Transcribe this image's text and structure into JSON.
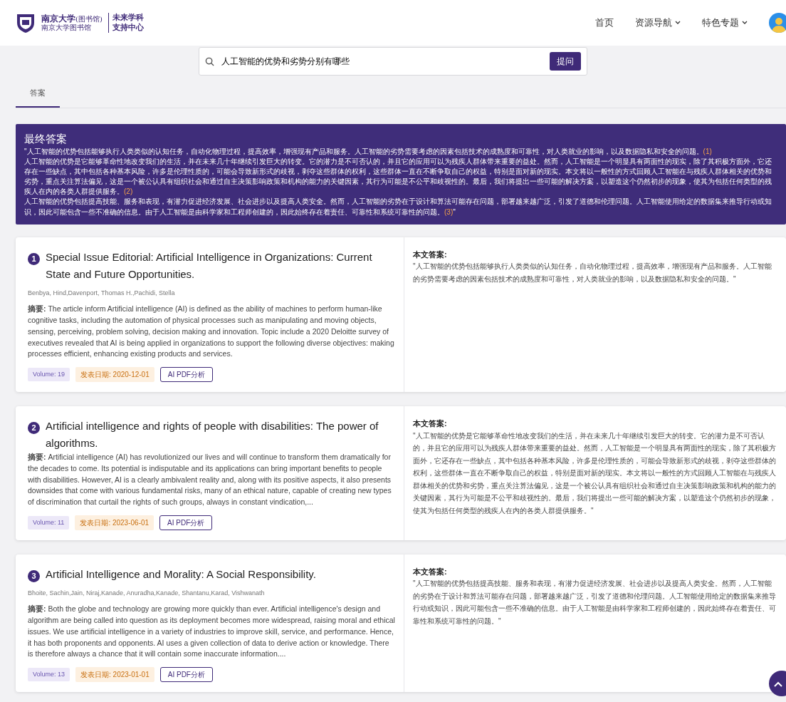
{
  "header": {
    "logo_line1": "南京大学",
    "logo_line1_small": "(图书馆)",
    "logo_line2": "南京大学图书馆",
    "logo_right_line1": "未来学科",
    "logo_right_line2": "支持中心",
    "nav": [
      {
        "label": "首页",
        "dropdown": false
      },
      {
        "label": "资源导航",
        "dropdown": true
      },
      {
        "label": "特色专题",
        "dropdown": true
      }
    ]
  },
  "search": {
    "value": "人工智能的优势和劣势分别有哪些",
    "button": "提问"
  },
  "tabs": [
    {
      "label": "答案",
      "selected": true
    }
  ],
  "final_answer": {
    "title": "最终答案",
    "closing_quote": "\"",
    "paragraphs": [
      {
        "text": "\"人工智能的优势包括能够执行人类类似的认知任务，自动化物理过程，提高效率，增强现有产品和服务。人工智能的劣势需要考虑的因素包括技术的成熟度和可靠性，对人类就业的影响，以及数据隐私和安全的问题。",
        "ref": "(1)"
      },
      {
        "text": "人工智能的优势是它能够革命性地改变我们的生活，并在未来几十年继续引发巨大的转变。它的潜力是不可否认的，并且它的应用可以为残疾人群体带来重要的益处。然而，人工智能是一个明显具有两面性的现实，除了其积极方面外，它还存在一些缺点，其中包括各种基本风险，许多是伦理性质的，可能会导致新形式的歧视，剥夺这些群体的权利，这些群体一直在不断争取自己的权益，特别是面对新的现实。本文将以一般性的方式回顾人工智能在与残疾人群体相关的优势和劣势，重点关注算法偏见，这是一个被公认具有组织社会和通过自主决策影响政策和机构的能力的关键因素，其行为可能是不公平和歧视性的。最后，我们将提出一些可能的解决方案，以塑造这个仍然初步的现象，使其为包括任何类型的残疾人在内的各类人群提供服务。",
        "ref": "(2)"
      },
      {
        "text": "人工智能的优势包括提高技能、服务和表现，有潜力促进经济发展、社会进步以及提高人类安全。然而，人工智能的劣势在于设计和算法可能存在问题，部署越来越广泛，引发了道德和伦理问题。人工智能使用给定的数据集来推导行动或知识，因此可能包含一些不准确的信息。由于人工智能是由科学家和工程师创建的，因此始终存在着责任、可靠性和系统可靠性的问题。",
        "ref": "(3)"
      }
    ]
  },
  "papers": [
    {
      "number": "1",
      "title": "Special Issue Editorial: Artificial Intelligence in Organizations: Current State and Future Opportunities.",
      "authors": "Benbya, Hind,Davenport, Thomas H.,Pachidi, Stella",
      "abstract_label": "摘要:",
      "abstract": "The article inform Artificial intelligence (AI) is defined as the ability of machines to perform human-like cognitive tasks, including the automation of physical processes such as manipulating and moving objects, sensing, perceiving, problem solving, decision making and innovation. Topic include a 2020 Deloitte survey of executives revealed that AI is being applied in organizations to support the following diverse objectives: making processes efficient, enhancing existing products and services.",
      "volume": "Volume: 19",
      "date": "发表日期: 2020-12-01",
      "button": "AI PDF分析",
      "answer_label": "本文答案:",
      "answer": "\"人工智能的优势包括能够执行人类类似的认知任务，自动化物理过程，提高效率，增强现有产品和服务。人工智能的劣势需要考虑的因素包括技术的成熟度和可靠性，对人类就业的影响，以及数据隐私和安全的问题。\""
    },
    {
      "number": "2",
      "title": "Artificial intelligence and rights of people with disabilities: The power of algorithms.",
      "abstract_label": "摘要:",
      "abstract": "Artificial intelligence (AI) has revolutionized our lives and will continue to transform them dramatically for the decades to come. Its potential is indisputable and its applications can bring important benefits to people with disabilities. However, AI is a clearly ambivalent reality and, along with its positive aspects, it also presents downsides that come with various fundamental risks, many of an ethical nature, capable of creating new types of discrimination that curtail the rights of such groups, always in constant vindication,...",
      "volume": "Volume: 11",
      "date": "发表日期: 2023-06-01",
      "button": "AI PDF分析",
      "answer_label": "本文答案:",
      "answer": "\"人工智能的优势是它能够革命性地改变我们的生活，并在未来几十年继续引发巨大的转变。它的潜力是不可否认的，并且它的应用可以为残疾人群体带来重要的益处。然而，人工智能是一个明显具有两面性的现实，除了其积极方面外，它还存在一些缺点，其中包括各种基本风险，许多是伦理性质的，可能会导致新形式的歧视，剥夺这些群体的权利，这些群体一直在不断争取自己的权益，特别是面对新的现实。本文将以一般性的方式回顾人工智能在与残疾人群体相关的优势和劣势，重点关注算法偏见，这是一个被公认具有组织社会和通过自主决策影响政策和机构的能力的关键因素，其行为可能是不公平和歧视性的。最后，我们将提出一些可能的解决方案，以塑造这个仍然初步的现象，使其为包括任何类型的残疾人在内的各类人群提供服务。\""
    },
    {
      "number": "3",
      "title": "Artificial Intelligence and Morality: A Social Responsibility.",
      "authors": "Bhoite, Sachin,Jain, Niraj,Kanade, Anuradha,Kanade, Shantanu,Karad, Vishwanath",
      "abstract_label": "摘要:",
      "abstract": "Both the globe and technology are growing more quickly than ever. Artificial intelligence's design and algorithm are being called into question as its deployment becomes more widespread, raising moral and ethical issues. We use artificial intelligence in a variety of industries to improve skill, service, and performance. Hence, it has both proponents and opponents. AI uses a given collection of data to derive action or knowledge. There is therefore always a chance that it will contain some inaccurate information....",
      "volume": "Volume: 13",
      "date": "发表日期: 2023-01-01",
      "button": "AI PDF分析",
      "answer_label": "本文答案:",
      "answer": "\"人工智能的优势包括提高技能、服务和表现，有潜力促进经济发展、社会进步以及提高人类安全。然而，人工智能的劣势在于设计和算法可能存在问题，部署越来越广泛，引发了道德和伦理问题。人工智能使用给定的数据集来推导行动或知识，因此可能包含一些不准确的信息。由于人工智能是由科学家和工程师创建的，因此始终存在着责任、可靠性和系统可靠性的问题。\""
    }
  ]
}
